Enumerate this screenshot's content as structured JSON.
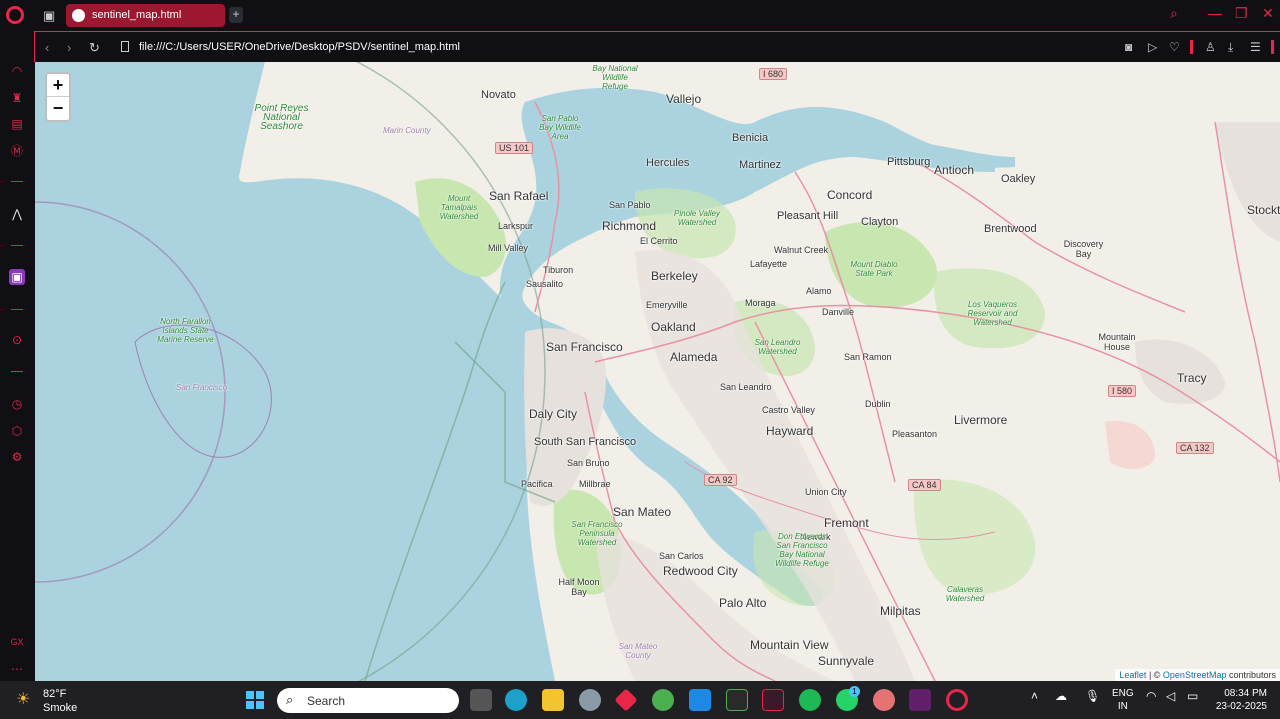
{
  "browser": {
    "tab_title": "sentinel_map.html",
    "url": "file:///C:/Users/USER/OneDrive/Desktop/PSDV/sentinel_map.html",
    "new_tab_label": "+"
  },
  "map": {
    "zoom_in": "+",
    "zoom_out": "−",
    "attribution_leaflet": "Leaflet",
    "attribution_sep": " | © ",
    "attribution_osm": "OpenStreetMap",
    "attribution_tail": " contributors",
    "labels": {
      "novato": "Novato",
      "vallejo": "Vallejo",
      "benicia": "Benicia",
      "hercules": "Hercules",
      "martinez": "Martinez",
      "pittsburg": "Pittsburg",
      "antioch": "Antioch",
      "oakley": "Oakley",
      "stockton": "Stockt",
      "concord": "Concord",
      "pleasant_hill": "Pleasant Hill",
      "clayton": "Clayton",
      "brentwood": "Brentwood",
      "discovery_bay": "Discovery Bay",
      "san_rafael": "San Rafael",
      "san_pablo": "San Pablo",
      "richmond": "Richmond",
      "larkspur": "Larkspur",
      "el_cerrito": "El Cerrito",
      "mill_valley": "Mill Valley",
      "walnut_creek": "Walnut Creek",
      "lafayette": "Lafayette",
      "berkeley": "Berkeley",
      "tiburon": "Tiburon",
      "sausalito": "Sausalito",
      "alamo": "Alamo",
      "moraga": "Moraga",
      "emeryville": "Emeryville",
      "danville": "Danville",
      "oakland": "Oakland",
      "san_francisco": "San Francisco",
      "alameda": "Alameda",
      "san_ramon": "San Ramon",
      "mountain_house": "Mountain House",
      "tracy": "Tracy",
      "san_leandro": "San Leandro",
      "daly_city": "Daly City",
      "castro_valley": "Castro Valley",
      "dublin": "Dublin",
      "livermore": "Livermore",
      "hayward": "Hayward",
      "pleasanton": "Pleasanton",
      "south_san_francisco": "South San Francisco",
      "san_bruno": "San Bruno",
      "pacifica": "Pacifica",
      "millbrae": "Millbrae",
      "union_city": "Union City",
      "san_mateo": "San Mateo",
      "fremont": "Fremont",
      "newark": "Newark",
      "san_carlos": "San Carlos",
      "redwood_city": "Redwood City",
      "half_moon_bay": "Half Moon Bay",
      "palo_alto": "Palo Alto",
      "milpitas": "Milpitas",
      "mountain_view": "Mountain View",
      "sunnyvale": "Sunnyvale",
      "marin_county": "Marin County",
      "san_mateo_county": "San Mateo County",
      "point_reyes": "Point Reyes National Seashore",
      "farallon": "North Farallon Islands State Marine Reserve",
      "farallon_sf": "San Francisco",
      "mount_tamalpais": "Mount Tamalpais Watershed",
      "san_pablo_bay": "San Pablo Bay Wildlife Area",
      "bay_natl_wildlife": "Bay National Wildlife Refuge",
      "pinole_valley": "Pinole Valley Watershed",
      "mount_diablo": "Mount Diablo State Park",
      "los_vaqueros": "Los Vaqueros Reservoir and Watershed",
      "san_leandro_ws": "San Leandro Watershed",
      "sf_peninsula_ws": "San Francisco Peninsula Watershed",
      "don_edwards": "Don Edwards San Francisco Bay National Wildlife Refuge",
      "calaveras": "Calaveras Watershed"
    },
    "shields": {
      "i680": "I 680",
      "us101": "US 101",
      "i580": "I 580",
      "ca132": "CA 132",
      "ca92": "CA 92",
      "ca84": "CA 84"
    }
  },
  "taskbar": {
    "temp": "82°F",
    "condition": "Smoke",
    "search_placeholder": "Search",
    "lang1": "ENG",
    "lang2": "IN",
    "time": "08:34 PM",
    "date": "23-02-2025",
    "whatsapp_badge": "1"
  },
  "colors": {
    "accent": "#e8264a",
    "water": "#aad3df",
    "land": "#f2efe9",
    "park": "#c8e6b0"
  }
}
